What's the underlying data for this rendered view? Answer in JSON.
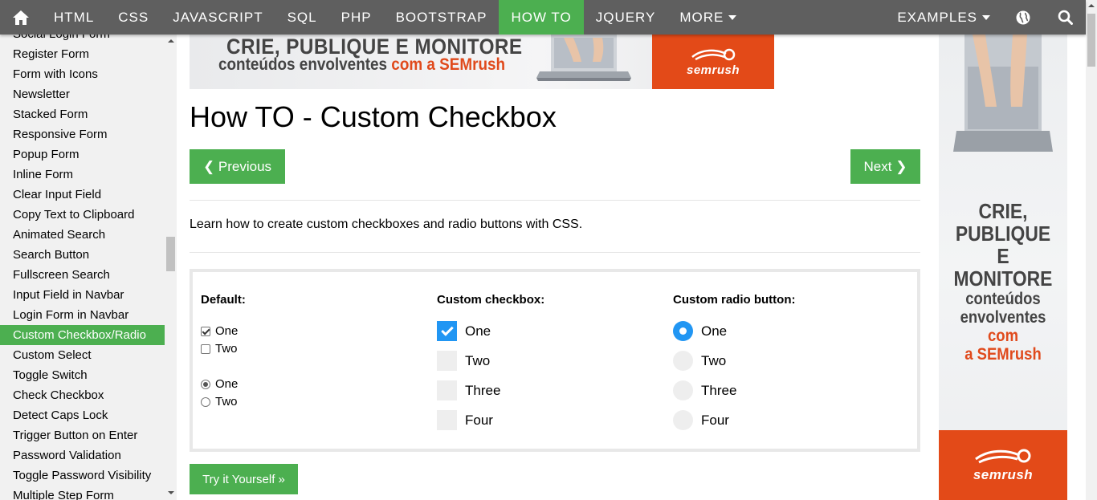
{
  "navbar": {
    "items": [
      "HTML",
      "CSS",
      "JAVASCRIPT",
      "SQL",
      "PHP",
      "BOOTSTRAP",
      "HOW TO",
      "JQUERY",
      "MORE"
    ],
    "active": "HOW TO",
    "examples_label": "EXAMPLES",
    "icons": [
      "home-icon",
      "globe-icon",
      "search-icon"
    ],
    "bg_color": "#5f5f5f",
    "active_color": "#4caf50"
  },
  "sidebar": {
    "items": [
      "Social Login Form",
      "Register Form",
      "Form with Icons",
      "Newsletter",
      "Stacked Form",
      "Responsive Form",
      "Popup Form",
      "Inline Form",
      "Clear Input Field",
      "Copy Text to Clipboard",
      "Animated Search",
      "Search Button",
      "Fullscreen Search",
      "Input Field in Navbar",
      "Login Form in Navbar",
      "Custom Checkbox/Radio",
      "Custom Select",
      "Toggle Switch",
      "Check Checkbox",
      "Detect Caps Lock",
      "Trigger Button on Enter",
      "Password Validation",
      "Toggle Password Visibility",
      "Multiple Step Form"
    ],
    "active_index": 15
  },
  "ad_top": {
    "line1": "CRIE, PUBLIQUE E MONITORE",
    "line2_a": "conteúdos envolventes ",
    "line2_b": "com a SEMrush",
    "brand": "SEMRUSH"
  },
  "ad_right": {
    "line1": "CRIE,",
    "line2": "PUBLIQUE",
    "line3": "E MONITORE",
    "line4": "conteúdos",
    "line5": "envolventes",
    "line6": "com",
    "line7": "a SEMrush",
    "brand": "SEMRUSH"
  },
  "main": {
    "title": "How TO - Custom Checkbox",
    "prev_label": "❮ Previous",
    "next_label": "Next ❯",
    "intro": "Learn how to create custom checkboxes and radio buttons with CSS.",
    "try_label": "Try it Yourself »",
    "accent_color": "#2196f3"
  },
  "demo": {
    "default": {
      "heading": "Default:",
      "checkboxes": [
        {
          "label": "One",
          "checked": true
        },
        {
          "label": "Two",
          "checked": false
        }
      ],
      "radios": [
        {
          "label": "One",
          "checked": true
        },
        {
          "label": "Two",
          "checked": false
        }
      ]
    },
    "custom_checkbox": {
      "heading": "Custom checkbox:",
      "options": [
        {
          "label": "One",
          "checked": true
        },
        {
          "label": "Two",
          "checked": false
        },
        {
          "label": "Three",
          "checked": false
        },
        {
          "label": "Four",
          "checked": false
        }
      ]
    },
    "custom_radio": {
      "heading": "Custom radio button:",
      "options": [
        {
          "label": "One",
          "checked": true
        },
        {
          "label": "Two",
          "checked": false
        },
        {
          "label": "Three",
          "checked": false
        },
        {
          "label": "Four",
          "checked": false
        }
      ]
    }
  }
}
